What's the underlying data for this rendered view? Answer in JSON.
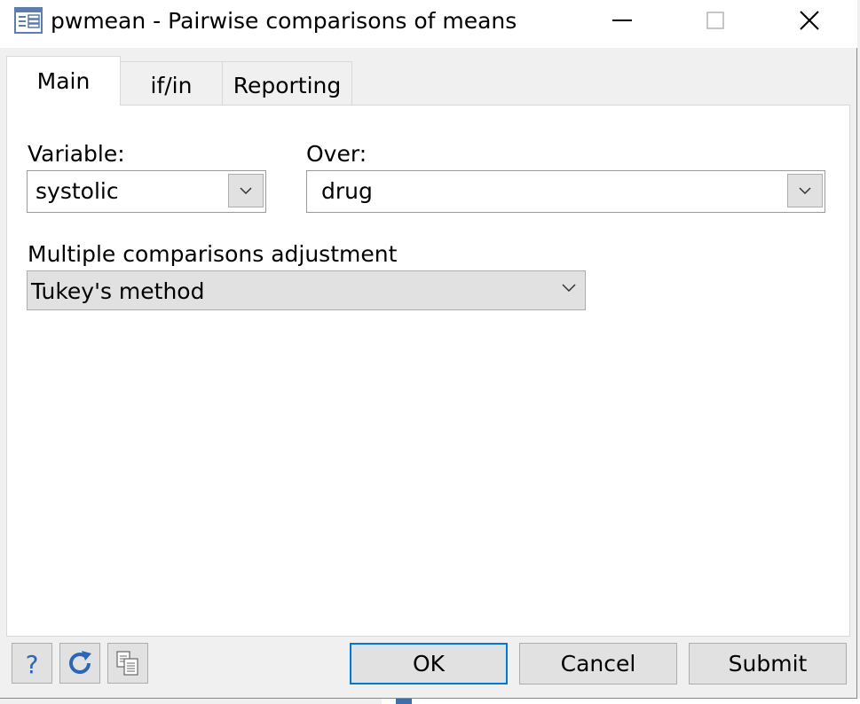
{
  "window": {
    "title": "pwmean - Pairwise comparisons of means"
  },
  "icons": {
    "app": "dialog-icon",
    "minimize": "minimize-icon",
    "maximize": "maximize-icon",
    "close": "close-icon",
    "dropdown": "chevron-down-icon",
    "help": "help-icon",
    "reset": "reset-icon",
    "copy": "copy-command-icon"
  },
  "tabs": [
    {
      "label": "Main",
      "selected": true
    },
    {
      "label": "if/in",
      "selected": false
    },
    {
      "label": "Reporting",
      "selected": false
    }
  ],
  "main": {
    "variable_label": "Variable:",
    "variable_value": "systolic",
    "over_label": "Over:",
    "over_value": "drug",
    "adjustment_label": "Multiple comparisons adjustment",
    "adjustment_value": "Tukey's method"
  },
  "footer": {
    "ok_label": "OK",
    "cancel_label": "Cancel",
    "submit_label": "Submit"
  },
  "colors": {
    "accent": "#0078d7",
    "help_blue": "#2b67b6",
    "button_face": "#e1e1e1",
    "window_bg": "#f0f0f0"
  }
}
